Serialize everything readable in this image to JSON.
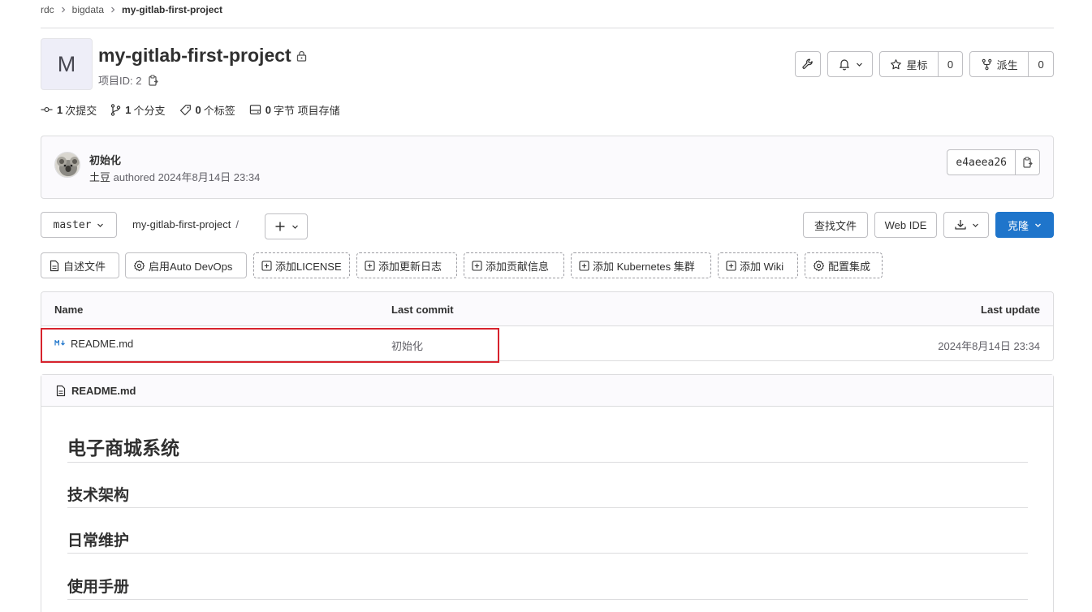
{
  "breadcrumb": {
    "items": [
      "rdc",
      "bigdata"
    ],
    "current": "my-gitlab-first-project"
  },
  "project": {
    "avatar_letter": "M",
    "title": "my-gitlab-first-project",
    "id_label": "项目ID: 2"
  },
  "actions": {
    "star_label": "星标",
    "star_count": "0",
    "fork_label": "派生",
    "fork_count": "0"
  },
  "stats": [
    {
      "count": "1",
      "label": "次提交",
      "icon": "commit-icon"
    },
    {
      "count": "1",
      "label": "个分支",
      "icon": "branch-icon"
    },
    {
      "count": "0",
      "label": "个标签",
      "icon": "tag-icon"
    },
    {
      "count": "0",
      "label": "字节 项目存储",
      "icon": "storage-icon"
    }
  ],
  "commit": {
    "message": "初始化",
    "author": "土豆",
    "authored_text": "authored 2024年8月14日 23:34",
    "sha": "e4aeea26"
  },
  "toolbar": {
    "branch": "master",
    "path": "my-gitlab-first-project",
    "path_sep": "/",
    "find_file": "查找文件",
    "web_ide": "Web IDE",
    "clone": "克隆"
  },
  "quick_actions": [
    {
      "label": "自述文件",
      "icon": "file-icon",
      "style": "solid"
    },
    {
      "label": "启用Auto DevOps",
      "icon": "settings-icon",
      "style": "solid"
    },
    {
      "label": "添加LICENSE",
      "icon": "plus-square-icon",
      "style": "dashed"
    },
    {
      "label": "添加更新日志",
      "icon": "plus-square-icon",
      "style": "dashed"
    },
    {
      "label": "添加贡献信息",
      "icon": "plus-square-icon",
      "style": "dashed"
    },
    {
      "label": "添加 Kubernetes 集群",
      "icon": "plus-square-icon",
      "style": "dashed"
    },
    {
      "label": "添加 Wiki",
      "icon": "plus-square-icon",
      "style": "dashed"
    },
    {
      "label": "配置集成",
      "icon": "settings-icon",
      "style": "dashed"
    }
  ],
  "file_table": {
    "headers": {
      "name": "Name",
      "last_commit": "Last commit",
      "last_update": "Last update"
    },
    "rows": [
      {
        "name": "README.md",
        "icon": "markdown-icon",
        "last_commit": "初始化",
        "last_update": "2024年8月14日 23:34"
      }
    ]
  },
  "readme": {
    "filename": "README.md",
    "headings": [
      "电子商城系统",
      "技术架构",
      "日常维护",
      "使用手册"
    ]
  },
  "colors": {
    "primary": "#1f75cb",
    "highlight_box": "#d7232d",
    "border": "#dcdcde"
  }
}
